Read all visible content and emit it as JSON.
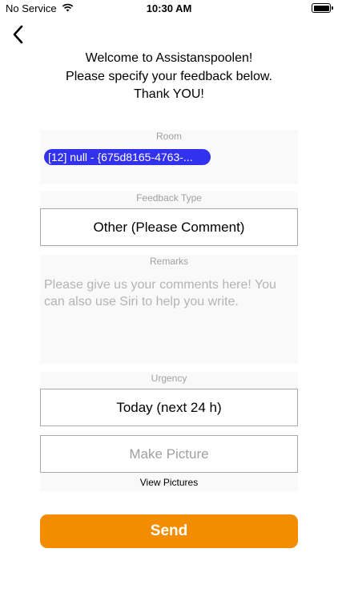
{
  "status_bar": {
    "carrier": "No Service",
    "time": "10:30 AM",
    "wifi_icon": "wifi-icon",
    "battery_icon": "battery-icon"
  },
  "nav": {
    "back_icon": "chevron-left-icon"
  },
  "welcome": {
    "line1": "Welcome to Assistanspoolen!",
    "line2": "Please specify your feedback below.",
    "line3": "Thank YOU!"
  },
  "room": {
    "label": "Room",
    "value": "[12] null - {675d8165-4763-..."
  },
  "feedback_type": {
    "label": "Feedback Type",
    "value": "Other (Please Comment)"
  },
  "remarks": {
    "label": "Remarks",
    "placeholder": "Please give us your comments here! You\ncan also use Siri to help you write."
  },
  "urgency": {
    "label": "Urgency",
    "value": "Today (next 24 h)"
  },
  "picture": {
    "button_label": "Make Picture",
    "view_label": "View Pictures"
  },
  "send": {
    "label": "Send"
  },
  "colors": {
    "accent": "#f28c00",
    "chip": "#3232ee"
  }
}
